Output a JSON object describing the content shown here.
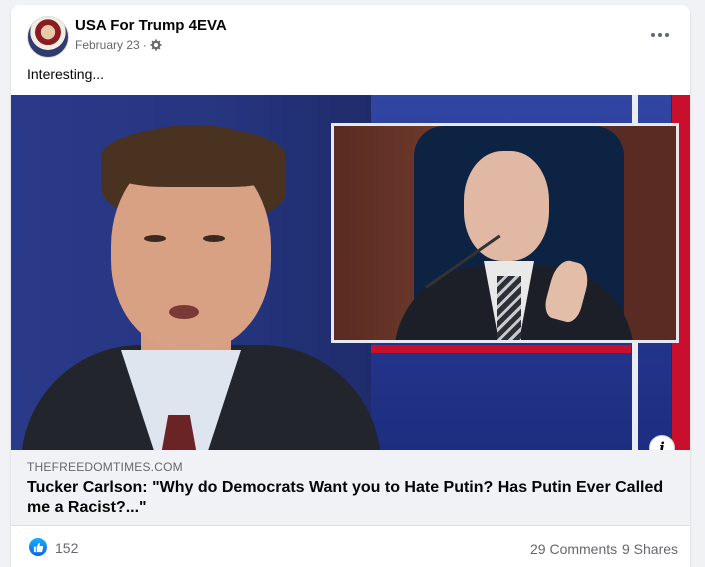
{
  "post": {
    "author": "USA For Trump 4EVA",
    "date": "February 23",
    "separator": "·",
    "audience_icon": "gear-icon",
    "text": "Interesting..."
  },
  "link_preview": {
    "domain": "THEFREEDOMTIMES.COM",
    "title": "Tucker Carlson: \"Why do Democrats Want you to Hate Putin? Has Putin Ever Called me a Racist?...\"",
    "info_label": "i"
  },
  "reactions": {
    "icon": "like-icon",
    "count": "152",
    "comments": "29 Comments",
    "shares": "9 Shares"
  },
  "colors": {
    "accent": "#1877f2",
    "secondary_text": "#65676b",
    "background": "#f0f2f5"
  }
}
